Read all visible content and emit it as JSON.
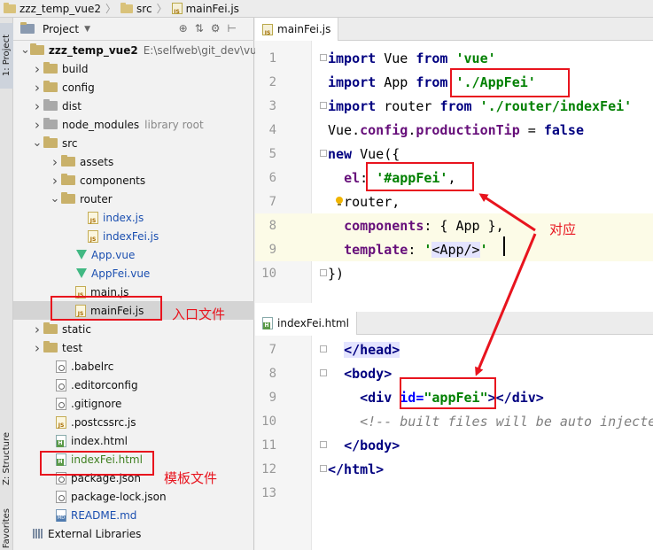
{
  "breadcrumb": [
    "zzz_temp_vue2",
    "src",
    "mainFei.js"
  ],
  "side_tabs": {
    "project": "1: Project",
    "structure": "Z: Structure",
    "favorites": "Favorites"
  },
  "project_panel": {
    "title": "Project",
    "rows": [
      {
        "label": "zzz_temp_vue2",
        "extra": "E:\\selfweb\\git_dev\\vue\\",
        "icon": "folder-icon",
        "arrow": "expanded"
      },
      {
        "label": "build",
        "icon": "folder-icon",
        "arrow": "collapsed"
      },
      {
        "label": "config",
        "icon": "folder-icon",
        "arrow": "collapsed"
      },
      {
        "label": "dist",
        "icon": "folder-icon",
        "arrow": "collapsed"
      },
      {
        "label": "node_modules",
        "extra": "library root",
        "icon": "folder-icon",
        "arrow": "collapsed"
      },
      {
        "label": "src",
        "icon": "folder-icon",
        "arrow": "expanded"
      },
      {
        "label": "assets",
        "icon": "folder-icon",
        "arrow": "collapsed"
      },
      {
        "label": "components",
        "icon": "folder-icon",
        "arrow": "collapsed"
      },
      {
        "label": "router",
        "icon": "folder-icon",
        "arrow": "expanded"
      },
      {
        "label": "index.js",
        "icon": "js-file-icon"
      },
      {
        "label": "indexFei.js",
        "icon": "js-file-icon"
      },
      {
        "label": "App.vue",
        "icon": "vue-file-icon"
      },
      {
        "label": "AppFei.vue",
        "icon": "vue-file-icon"
      },
      {
        "label": "main.js",
        "icon": "js-file-icon"
      },
      {
        "label": "mainFei.js",
        "icon": "js-file-icon"
      },
      {
        "label": "static",
        "icon": "folder-icon",
        "arrow": "collapsed"
      },
      {
        "label": "test",
        "icon": "folder-icon",
        "arrow": "collapsed"
      },
      {
        "label": ".babelrc",
        "icon": "config-file-icon"
      },
      {
        "label": ".editorconfig",
        "icon": "config-file-icon"
      },
      {
        "label": ".gitignore",
        "icon": "config-file-icon"
      },
      {
        "label": ".postcssrc.js",
        "icon": "js-file-icon"
      },
      {
        "label": "index.html",
        "icon": "html-file-icon"
      },
      {
        "label": "indexFei.html",
        "icon": "html-file-icon"
      },
      {
        "label": "package.json",
        "icon": "json-file-icon"
      },
      {
        "label": "package-lock.json",
        "icon": "json-file-icon"
      },
      {
        "label": "README.md",
        "icon": "md-file-icon"
      },
      {
        "label": "External Libraries",
        "icon": "library-icon"
      }
    ]
  },
  "annotations": {
    "entry": "入口文件",
    "template": "模板文件",
    "corresponds": "对应"
  },
  "editor_top": {
    "tab": "mainFei.js",
    "lines": [
      {
        "num": "1",
        "html": "<span class='kw'>import</span> Vue <span class='kw'>from</span> <span class='str'>'vue'</span>"
      },
      {
        "num": "2",
        "html": "<span class='kw'>import</span> App <span class='kw'>from</span> <span class='str'>'./AppFei'</span>"
      },
      {
        "num": "3",
        "html": "<span class='kw'>import</span> router <span class='kw'>from</span> <span class='str'>'./router/indexFei'</span>"
      },
      {
        "num": "4",
        "html": "Vue.<span class='prop'>config</span>.<span class='prop'>productionTip</span> = <span class='kw'>false</span>"
      },
      {
        "num": "5",
        "html": "<span class='kw'>new</span> Vue({"
      },
      {
        "num": "6",
        "html": "  <span class='prop'>el</span>: <span class='str'>'#appFei'</span>,"
      },
      {
        "num": "7",
        "html": "  router,"
      },
      {
        "num": "8",
        "html": "  <span class='prop'>components</span>: { App },"
      },
      {
        "num": "9",
        "html": "  <span class='prop'>template</span>: <span class='str'>'</span><span class='tagsel'>&lt;App/&gt;</span><span class='str'>'</span>"
      },
      {
        "num": "10",
        "html": "})"
      }
    ]
  },
  "editor_bottom": {
    "tab": "indexFei.html",
    "lines": [
      {
        "num": "7",
        "html": "  <span class='tagc tagsel'>&lt;/head&gt;</span>"
      },
      {
        "num": "8",
        "html": "  <span class='tagc'>&lt;body&gt;</span>"
      },
      {
        "num": "9",
        "html": "    <span class='tagc'>&lt;div</span> <span class='attr'>id=</span><span class='str'>\"appFei\"</span><span class='tagc'>&gt;&lt;/div&gt;</span>"
      },
      {
        "num": "10",
        "html": "    <span class='cmt'>&lt;!-- built files will be auto injected --&gt;</span>"
      },
      {
        "num": "11",
        "html": "  <span class='tagc'>&lt;/body&gt;</span>"
      },
      {
        "num": "12",
        "html": "<span class='tagc'>&lt;/html&gt;</span>"
      },
      {
        "num": "13",
        "html": ""
      }
    ]
  }
}
